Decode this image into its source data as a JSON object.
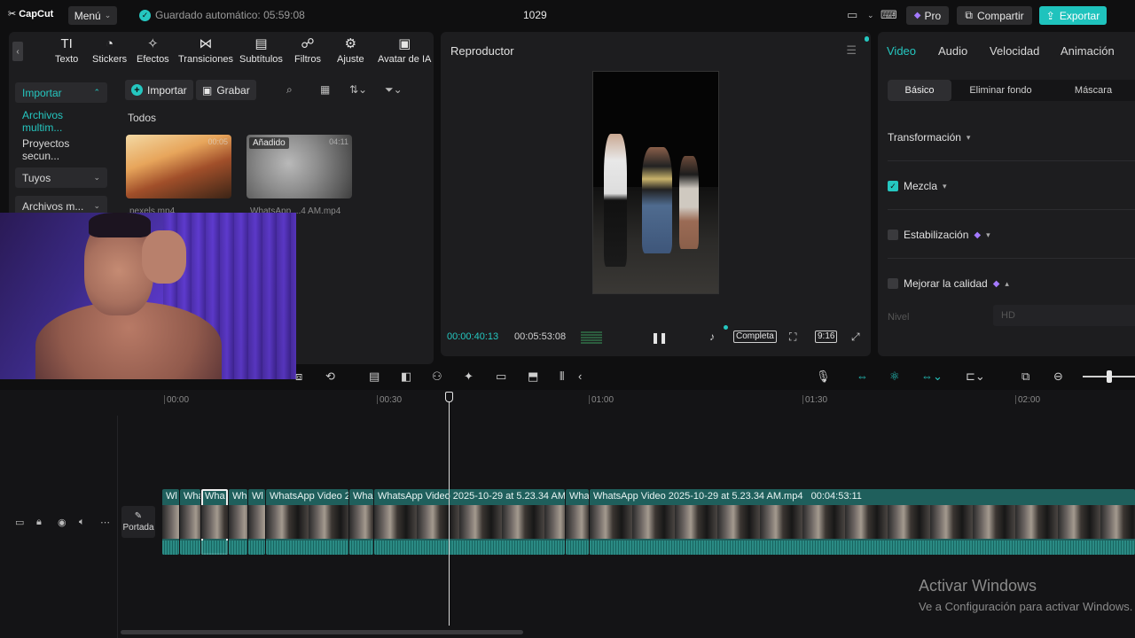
{
  "app": {
    "logo": "CapCut",
    "menu": "Menú",
    "autosave": "Guardado automático: 05:59:08",
    "project_title": "1029",
    "pro": "Pro",
    "share": "Compartir",
    "export": "Exportar"
  },
  "toolbar": {
    "items": [
      {
        "label": "Texto",
        "icon": "T"
      },
      {
        "label": "Stickers",
        "icon": "◔"
      },
      {
        "label": "Efectos",
        "icon": "✧"
      },
      {
        "label": "Transiciones",
        "icon": "⋈"
      },
      {
        "label": "Subtítulos",
        "icon": "▤"
      },
      {
        "label": "Filtros",
        "icon": "☍"
      },
      {
        "label": "Ajuste",
        "icon": "⚙"
      },
      {
        "label": "Avatar de IA",
        "icon": "▣"
      }
    ]
  },
  "sidebar": {
    "import": "Importar",
    "media_files": "Archivos multim...",
    "secondary_projects": "Proyectos secun...",
    "yours": "Tuyos",
    "media_files_2": "Archivos m..."
  },
  "media": {
    "import_btn": "Importar",
    "record_btn": "Grabar",
    "section_label": "Todos",
    "items": [
      {
        "name": "pexels.mp4",
        "duration": "00:05",
        "added": ""
      },
      {
        "name": "WhatsApp ...4 AM.mp4",
        "duration": "04:11",
        "added": "Añadido"
      }
    ]
  },
  "player": {
    "title": "Reproductor",
    "current_time": "00:00:40:13",
    "total_time": "00:05:53:08",
    "full": "Completa",
    "ratio": "9:16"
  },
  "right_panel": {
    "tabs": [
      "Video",
      "Audio",
      "Velocidad",
      "Animación"
    ],
    "sub_tabs": [
      "Básico",
      "Eliminar fondo",
      "Máscara"
    ],
    "transform": "Transformación",
    "blend": "Mezcla",
    "stabilization": "Estabilización",
    "enhance": "Mejorar la calidad",
    "level_label": "Nivel",
    "level_value": "HD"
  },
  "timeline": {
    "ruler": [
      "00:00",
      "00:30",
      "01:00",
      "01:30",
      "02:00"
    ],
    "cover": "Portada",
    "clips": [
      {
        "label": "Wl"
      },
      {
        "label": "Wha"
      },
      {
        "label": "Wha"
      },
      {
        "label": "Wh"
      },
      {
        "label": "Wl"
      },
      {
        "label": "WhatsApp Video 2"
      },
      {
        "label": "Wha"
      },
      {
        "label": "WhatsApp Video 2025-10-29 at 5.23.34 AM.r"
      },
      {
        "label": "Wha"
      },
      {
        "label": "WhatsApp Video 2025-10-29 at 5.23.34 AM.mp4"
      }
    ],
    "last_clip_duration": "00:04:53:11"
  },
  "windows": {
    "activate": "Activar Windows",
    "activate_sub": "Ve a Configuración para activar Windows."
  },
  "colors": {
    "accent": "#25c7c0",
    "panel": "#1d1d1f",
    "background": "#0f0f10"
  }
}
